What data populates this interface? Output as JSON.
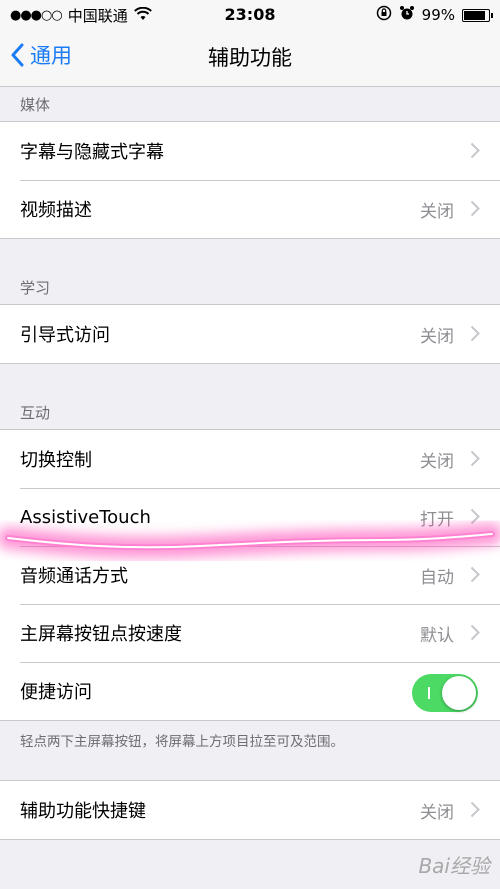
{
  "status_bar": {
    "signal": "●●●○○",
    "carrier": "中国联通",
    "time": "23:08",
    "battery": "99%",
    "battery_level": 0.99
  },
  "nav": {
    "back_label": "通用",
    "title": "辅助功能"
  },
  "sections": {
    "media": {
      "header": "媒体",
      "rows": [
        {
          "label": "字幕与隐藏式字幕",
          "value": ""
        },
        {
          "label": "视频描述",
          "value": "关闭"
        }
      ]
    },
    "learning": {
      "header": "学习",
      "rows": [
        {
          "label": "引导式访问",
          "value": "关闭"
        }
      ]
    },
    "interaction": {
      "header": "互动",
      "rows": [
        {
          "label": "切换控制",
          "value": "关闭"
        },
        {
          "label": "AssistiveTouch",
          "value": "打开"
        },
        {
          "label": "音频通话方式",
          "value": "自动"
        },
        {
          "label": "主屏幕按钮点按速度",
          "value": "默认"
        },
        {
          "label": "便捷访问",
          "toggle_on": true
        }
      ],
      "footer": "轻点两下主屏幕按钮，将屏幕上方项目拉至可及范围。"
    },
    "shortcut": {
      "rows": [
        {
          "label": "辅助功能快捷键",
          "value": "关闭"
        }
      ]
    }
  },
  "watermark": "Bai经验",
  "colors": {
    "accent": "#1a7cf5",
    "toggle_on": "#4cd964",
    "highlight": "#ff3fb4"
  }
}
